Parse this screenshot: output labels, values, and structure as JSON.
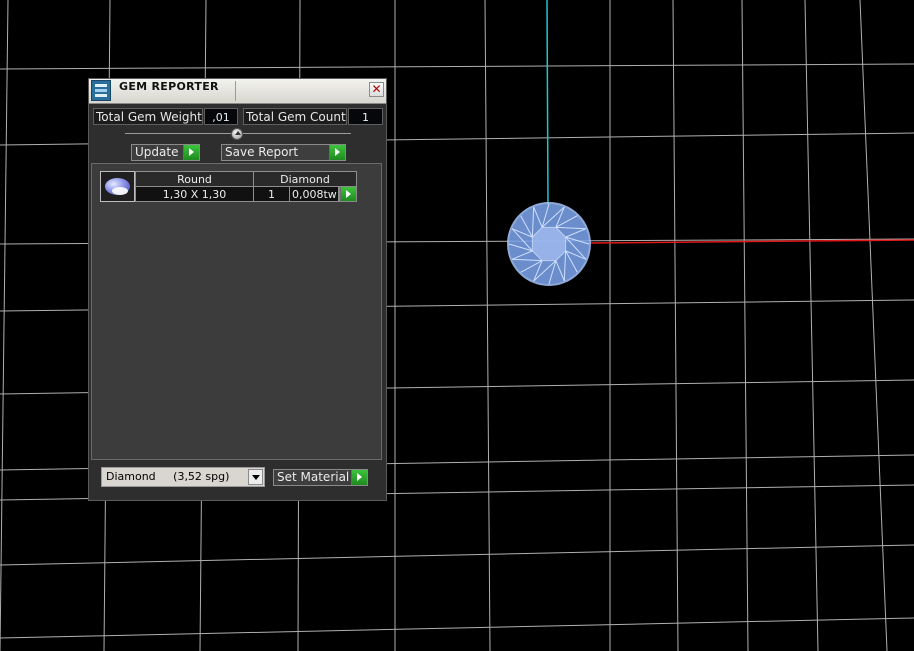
{
  "panel": {
    "title": "GEM REPORTER",
    "close_glyph": "✕",
    "total_weight_label": "Total Gem Weight",
    "total_weight_value": ",01",
    "total_count_label": "Total Gem Count",
    "total_count_value": "1",
    "update_label": "Update",
    "save_report_label": "Save Report",
    "rows": [
      {
        "shape": "Round",
        "material": "Diamond",
        "size": "1,30 X 1,30",
        "qty": "1",
        "weight": "0,008tw"
      }
    ],
    "material_select": {
      "value": "Diamond     (3,52 spg)"
    },
    "set_material_label": "Set Material"
  },
  "viewport": {
    "background": "#000000",
    "grid_color": "#c8c8c8",
    "axis_x_color": "#e02020",
    "axis_y_color": "#20c8d0",
    "gem_color": "#8fb4ff"
  }
}
